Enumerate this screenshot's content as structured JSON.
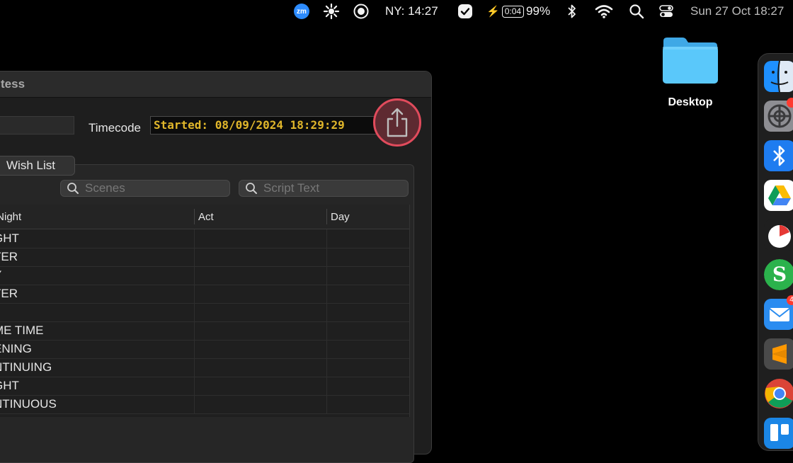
{
  "menubar": {
    "zoom_label": "zm",
    "clock": "NY: 14:27",
    "battery_time": "0:04",
    "battery_percent": "99%",
    "datetime": "Sun 27 Oct  18:27"
  },
  "window": {
    "title": "tess",
    "timecode_label": "Timecode",
    "timecode_value": "Started: 08/09/2024 18:29:29",
    "tab_label": "Wish List",
    "search_scenes_placeholder": "Scenes",
    "search_script_placeholder": "Script Text",
    "columns": [
      "/Night",
      "Act",
      "Day"
    ],
    "rows": [
      "GHT",
      "TER",
      "Y",
      "TER",
      "",
      "ME TIME",
      "ENING",
      "NTINUING",
      "GHT",
      "NTINUOUS"
    ]
  },
  "desktop": {
    "folder_label": "Desktop"
  },
  "dock": {
    "mail_badge": "4"
  },
  "colors": {
    "accent_timecode": "#e1b72b",
    "share_ring": "#e14b5c",
    "folder_blue": "#5ac8fa"
  }
}
